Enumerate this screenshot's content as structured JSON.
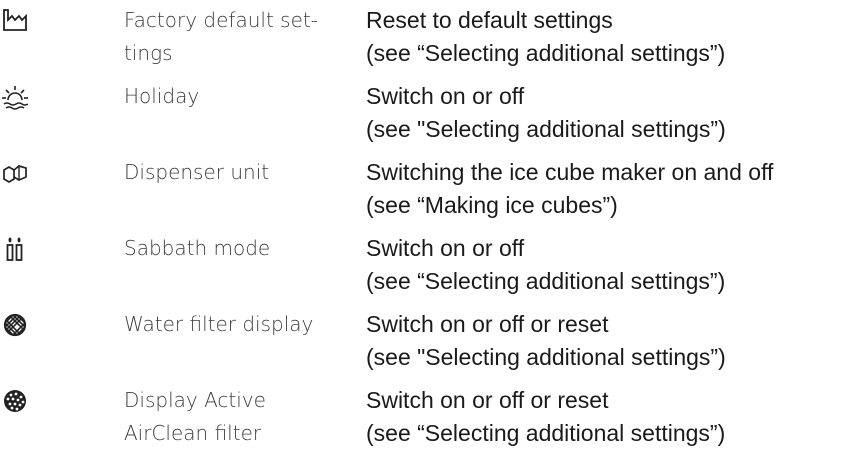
{
  "rows": [
    {
      "icon": "factory-icon",
      "name": "Factory default set-\ntings",
      "desc_line1": "Reset to default settings",
      "desc_line2": "(see “Selecting additional settings”)"
    },
    {
      "icon": "holiday-sun-icon",
      "name": "Holiday",
      "desc_line1": "Switch on or off",
      "desc_line2": "(see \"Selecting additional settings”)"
    },
    {
      "icon": "ice-cubes-icon",
      "name": "Dispenser unit",
      "desc_line1": "Switching the ice cube maker on and off",
      "desc_line2": "(see “Making ice cubes”)"
    },
    {
      "icon": "sabbath-candles-icon",
      "name": "Sabbath mode",
      "desc_line1": "Switch on or off",
      "desc_line2": "(see “Selecting additional settings”)"
    },
    {
      "icon": "water-filter-icon",
      "name": "Water filter display",
      "desc_line1": "Switch on or off or reset",
      "desc_line2": "(see \"Selecting additional settings”)"
    },
    {
      "icon": "airclean-filter-icon",
      "name": "Display Active\nAirClean filter",
      "desc_line1": "Switch on or off or reset",
      "desc_line2": "(see “Selecting additional settings”)"
    }
  ]
}
